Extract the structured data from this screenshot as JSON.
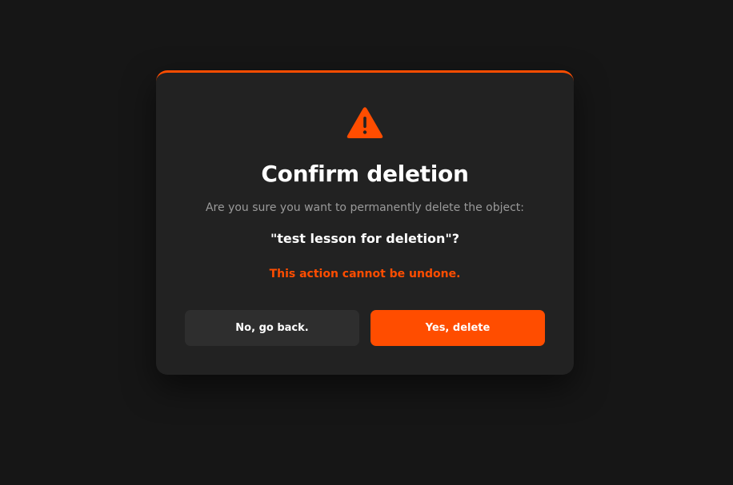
{
  "colors": {
    "background": "#161616",
    "modal": "#222222",
    "accent": "#ff4d00",
    "cancel_button": "#2e2e2e",
    "muted_text": "#9a9a9a"
  },
  "dialog": {
    "icon": "warning-triangle-icon",
    "title": "Confirm deletion",
    "question": "Are you sure you want to permanently delete the object:",
    "object_name": "\"test lesson for deletion\"?",
    "warning": "This action cannot be undone.",
    "cancel_label": "No, go back.",
    "confirm_label": "Yes, delete"
  }
}
